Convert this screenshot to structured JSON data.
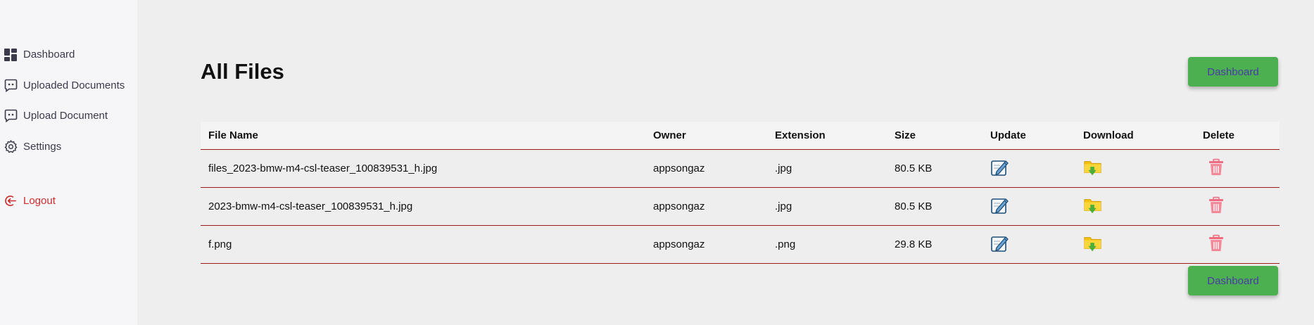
{
  "sidebar": {
    "items": [
      {
        "label": "Dashboard",
        "icon": "dashboard-icon"
      },
      {
        "label": "Uploaded Documents",
        "icon": "chat-icon"
      },
      {
        "label": "Upload Document",
        "icon": "chat-icon"
      },
      {
        "label": "Settings",
        "icon": "gear-icon"
      }
    ],
    "logout": {
      "label": "Logout",
      "icon": "logout-icon"
    }
  },
  "main": {
    "title": "All Files",
    "dashboard_button": "Dashboard",
    "table": {
      "headers": [
        "File Name",
        "Owner",
        "Extension",
        "Size",
        "Update",
        "Download",
        "Delete"
      ],
      "rows": [
        {
          "file_name": "files_2023-bmw-m4-csl-teaser_100839531_h.jpg",
          "owner": "appsongaz",
          "extension": ".jpg",
          "size": "80.5 KB"
        },
        {
          "file_name": "2023-bmw-m4-csl-teaser_100839531_h.jpg",
          "owner": "appsongaz",
          "extension": ".jpg",
          "size": "80.5 KB"
        },
        {
          "file_name": "f.png",
          "owner": "appsongaz",
          "extension": ".png",
          "size": "29.8 KB"
        }
      ]
    }
  },
  "colors": {
    "sidebar_bg": "#f6f6f9",
    "page_bg": "#eeeeee",
    "button_bg": "#4caf50",
    "button_text": "#4a3aa8",
    "row_border": "#9b1b1b",
    "logout": "#cc2b2b",
    "delete_icon": "#f06b80"
  }
}
